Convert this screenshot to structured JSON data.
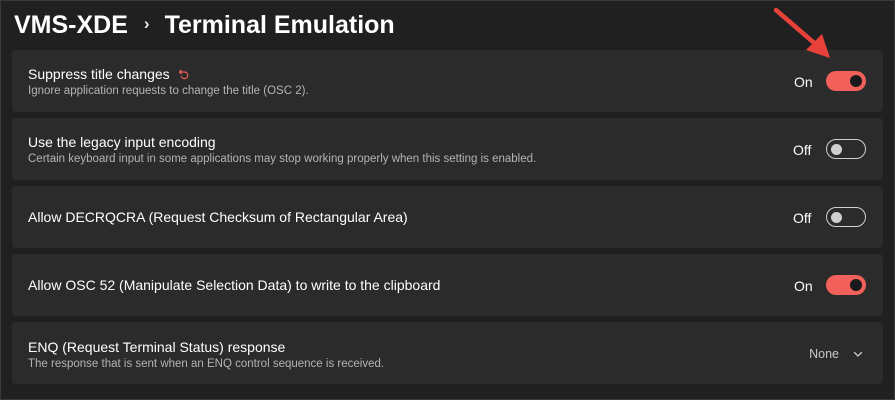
{
  "breadcrumb": {
    "parent": "VMS-XDE",
    "separator": "›",
    "current": "Terminal Emulation"
  },
  "settings": [
    {
      "title": "Suppress title changes",
      "description": "Ignore application requests to change the title (OSC 2).",
      "state_label": "On",
      "is_on": true,
      "has_reset_icon": true
    },
    {
      "title": "Use the legacy input encoding",
      "description": "Certain keyboard input in some applications may stop working properly when this setting is enabled.",
      "state_label": "Off",
      "is_on": false
    },
    {
      "title": "Allow DECRQCRA (Request Checksum of Rectangular Area)",
      "state_label": "Off",
      "is_on": false
    },
    {
      "title": "Allow OSC 52 (Manipulate Selection Data) to write to the clipboard",
      "state_label": "On",
      "is_on": true
    },
    {
      "title": "ENQ (Request Terminal Status) response",
      "description": "The response that is sent when an ENQ control sequence is received.",
      "dropdown_value": "None"
    }
  ],
  "colors": {
    "accent": "#f1605a",
    "background": "#202020",
    "card": "#2b2b2b",
    "annotation_arrow": "#e8413a"
  },
  "icons": {
    "reset": "reset-icon",
    "chevron": "chevron-down-icon",
    "annotation": "arrow-annotation-icon"
  }
}
